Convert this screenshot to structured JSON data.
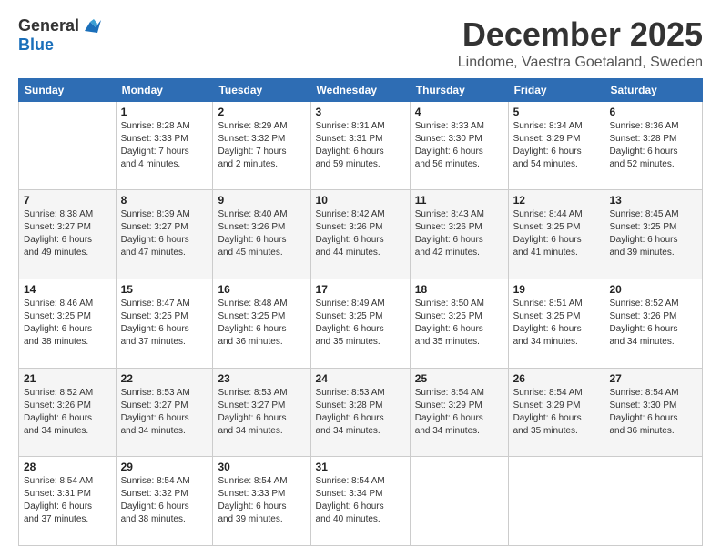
{
  "logo": {
    "general": "General",
    "blue": "Blue"
  },
  "title": "December 2025",
  "location": "Lindome, Vaestra Goetaland, Sweden",
  "days_of_week": [
    "Sunday",
    "Monday",
    "Tuesday",
    "Wednesday",
    "Thursday",
    "Friday",
    "Saturday"
  ],
  "weeks": [
    [
      {
        "day": "",
        "info": ""
      },
      {
        "day": "1",
        "info": "Sunrise: 8:28 AM\nSunset: 3:33 PM\nDaylight: 7 hours\nand 4 minutes."
      },
      {
        "day": "2",
        "info": "Sunrise: 8:29 AM\nSunset: 3:32 PM\nDaylight: 7 hours\nand 2 minutes."
      },
      {
        "day": "3",
        "info": "Sunrise: 8:31 AM\nSunset: 3:31 PM\nDaylight: 6 hours\nand 59 minutes."
      },
      {
        "day": "4",
        "info": "Sunrise: 8:33 AM\nSunset: 3:30 PM\nDaylight: 6 hours\nand 56 minutes."
      },
      {
        "day": "5",
        "info": "Sunrise: 8:34 AM\nSunset: 3:29 PM\nDaylight: 6 hours\nand 54 minutes."
      },
      {
        "day": "6",
        "info": "Sunrise: 8:36 AM\nSunset: 3:28 PM\nDaylight: 6 hours\nand 52 minutes."
      }
    ],
    [
      {
        "day": "7",
        "info": "Sunrise: 8:38 AM\nSunset: 3:27 PM\nDaylight: 6 hours\nand 49 minutes."
      },
      {
        "day": "8",
        "info": "Sunrise: 8:39 AM\nSunset: 3:27 PM\nDaylight: 6 hours\nand 47 minutes."
      },
      {
        "day": "9",
        "info": "Sunrise: 8:40 AM\nSunset: 3:26 PM\nDaylight: 6 hours\nand 45 minutes."
      },
      {
        "day": "10",
        "info": "Sunrise: 8:42 AM\nSunset: 3:26 PM\nDaylight: 6 hours\nand 44 minutes."
      },
      {
        "day": "11",
        "info": "Sunrise: 8:43 AM\nSunset: 3:26 PM\nDaylight: 6 hours\nand 42 minutes."
      },
      {
        "day": "12",
        "info": "Sunrise: 8:44 AM\nSunset: 3:25 PM\nDaylight: 6 hours\nand 41 minutes."
      },
      {
        "day": "13",
        "info": "Sunrise: 8:45 AM\nSunset: 3:25 PM\nDaylight: 6 hours\nand 39 minutes."
      }
    ],
    [
      {
        "day": "14",
        "info": "Sunrise: 8:46 AM\nSunset: 3:25 PM\nDaylight: 6 hours\nand 38 minutes."
      },
      {
        "day": "15",
        "info": "Sunrise: 8:47 AM\nSunset: 3:25 PM\nDaylight: 6 hours\nand 37 minutes."
      },
      {
        "day": "16",
        "info": "Sunrise: 8:48 AM\nSunset: 3:25 PM\nDaylight: 6 hours\nand 36 minutes."
      },
      {
        "day": "17",
        "info": "Sunrise: 8:49 AM\nSunset: 3:25 PM\nDaylight: 6 hours\nand 35 minutes."
      },
      {
        "day": "18",
        "info": "Sunrise: 8:50 AM\nSunset: 3:25 PM\nDaylight: 6 hours\nand 35 minutes."
      },
      {
        "day": "19",
        "info": "Sunrise: 8:51 AM\nSunset: 3:25 PM\nDaylight: 6 hours\nand 34 minutes."
      },
      {
        "day": "20",
        "info": "Sunrise: 8:52 AM\nSunset: 3:26 PM\nDaylight: 6 hours\nand 34 minutes."
      }
    ],
    [
      {
        "day": "21",
        "info": "Sunrise: 8:52 AM\nSunset: 3:26 PM\nDaylight: 6 hours\nand 34 minutes."
      },
      {
        "day": "22",
        "info": "Sunrise: 8:53 AM\nSunset: 3:27 PM\nDaylight: 6 hours\nand 34 minutes."
      },
      {
        "day": "23",
        "info": "Sunrise: 8:53 AM\nSunset: 3:27 PM\nDaylight: 6 hours\nand 34 minutes."
      },
      {
        "day": "24",
        "info": "Sunrise: 8:53 AM\nSunset: 3:28 PM\nDaylight: 6 hours\nand 34 minutes."
      },
      {
        "day": "25",
        "info": "Sunrise: 8:54 AM\nSunset: 3:29 PM\nDaylight: 6 hours\nand 34 minutes."
      },
      {
        "day": "26",
        "info": "Sunrise: 8:54 AM\nSunset: 3:29 PM\nDaylight: 6 hours\nand 35 minutes."
      },
      {
        "day": "27",
        "info": "Sunrise: 8:54 AM\nSunset: 3:30 PM\nDaylight: 6 hours\nand 36 minutes."
      }
    ],
    [
      {
        "day": "28",
        "info": "Sunrise: 8:54 AM\nSunset: 3:31 PM\nDaylight: 6 hours\nand 37 minutes."
      },
      {
        "day": "29",
        "info": "Sunrise: 8:54 AM\nSunset: 3:32 PM\nDaylight: 6 hours\nand 38 minutes."
      },
      {
        "day": "30",
        "info": "Sunrise: 8:54 AM\nSunset: 3:33 PM\nDaylight: 6 hours\nand 39 minutes."
      },
      {
        "day": "31",
        "info": "Sunrise: 8:54 AM\nSunset: 3:34 PM\nDaylight: 6 hours\nand 40 minutes."
      },
      {
        "day": "",
        "info": ""
      },
      {
        "day": "",
        "info": ""
      },
      {
        "day": "",
        "info": ""
      }
    ]
  ]
}
